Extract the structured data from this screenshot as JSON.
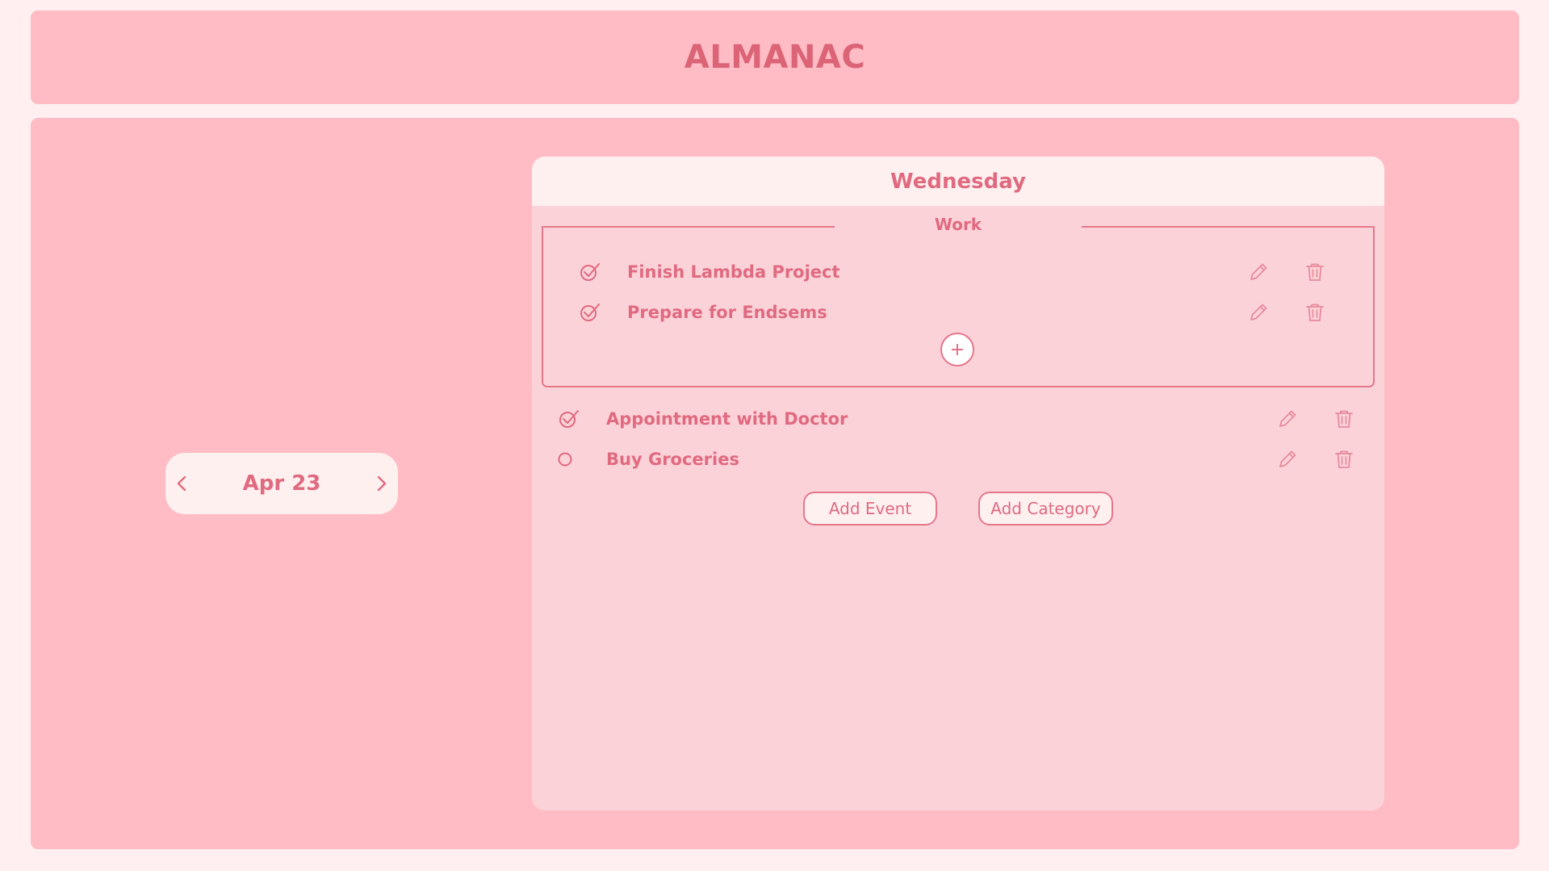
{
  "app": {
    "title": "ALMANAC"
  },
  "date_nav": {
    "label": "Apr 23",
    "prev_icon": "chevron-left-icon",
    "next_icon": "chevron-right-icon"
  },
  "day": {
    "title": "Wednesday"
  },
  "category": {
    "name": "Work",
    "tasks": [
      {
        "label": "Finish Lambda Project",
        "completed": true
      },
      {
        "label": "Prepare for Endsems",
        "completed": true
      }
    ],
    "add_icon": "plus-icon",
    "add_label": "+"
  },
  "events": [
    {
      "label": "Appointment with Doctor",
      "completed": true
    },
    {
      "label": "Buy Groceries",
      "completed": false
    }
  ],
  "actions": {
    "add_event_label": "Add Event",
    "add_category_label": "Add Category"
  },
  "icons": {
    "edit": "pencil-icon",
    "delete": "trash-icon",
    "done": "check-circle-icon",
    "pending": "empty-circle-icon"
  },
  "colors": {
    "page_bg": "#ffeff0",
    "card_bg": "#ffbcc5",
    "panel_bg": "#fcd2d9",
    "panel_header_bg": "#fff0f0",
    "accent": "#e06a80"
  }
}
